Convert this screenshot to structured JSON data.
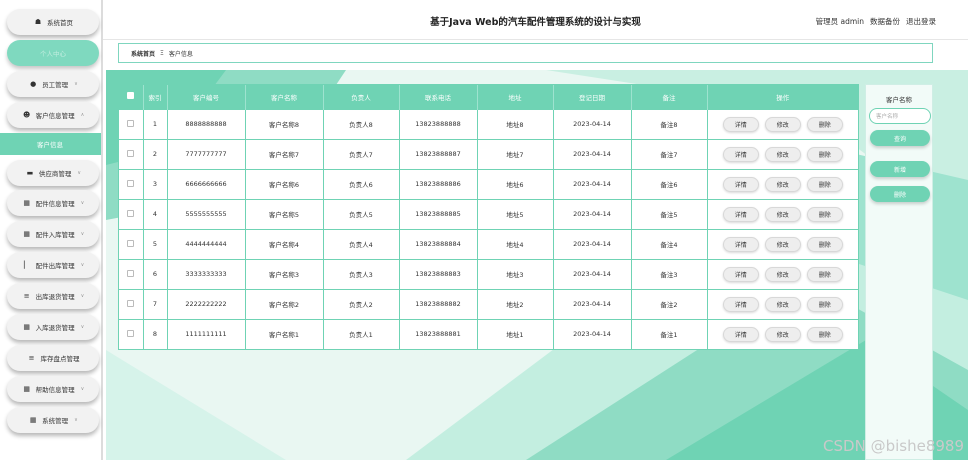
{
  "header": {
    "title": "基于Java Web的汽车配件管理系统的设计与实现",
    "user": "管理员 admin",
    "backup": "数据备份",
    "logout": "退出登录"
  },
  "sidebar": {
    "items": [
      {
        "icon": "home-icon",
        "label": "系统首页"
      },
      {
        "icon": "",
        "label": "个人中心"
      },
      {
        "icon": "pin-icon",
        "label": "员工管理"
      },
      {
        "icon": "person-icon",
        "label": "客户信息管理"
      },
      {
        "sub": "客户信息"
      },
      {
        "icon": "list-icon",
        "label": "供应商管理"
      },
      {
        "icon": "grid-icon",
        "label": "配件信息管理"
      },
      {
        "icon": "grid-icon",
        "label": "配件入库管理"
      },
      {
        "icon": "bar-chart-icon",
        "label": "配件出库管理"
      },
      {
        "icon": "sliders-icon",
        "label": "出库退货管理"
      },
      {
        "icon": "grid-icon",
        "label": "入库退货管理"
      },
      {
        "icon": "menu-icon",
        "label": "库存盘点管理"
      },
      {
        "icon": "grid-icon",
        "label": "帮助信息管理"
      },
      {
        "icon": "table-icon",
        "label": "系统管理"
      }
    ]
  },
  "breadcrumb": {
    "home": "系统首页",
    "separator": "Ξ",
    "current": "客户信息"
  },
  "table": {
    "headers": [
      "索引",
      "客户编号",
      "客户名称",
      "负责人",
      "联系电话",
      "地址",
      "登记日期",
      "备注",
      "操作"
    ],
    "rows": [
      {
        "idx": "1",
        "code": "8888888888",
        "name": "客户名称8",
        "owner": "负责人8",
        "phone": "13823888888",
        "addr": "地址8",
        "date": "2023-04-14",
        "note": "备注8"
      },
      {
        "idx": "2",
        "code": "7777777777",
        "name": "客户名称7",
        "owner": "负责人7",
        "phone": "13823888887",
        "addr": "地址7",
        "date": "2023-04-14",
        "note": "备注7"
      },
      {
        "idx": "3",
        "code": "6666666666",
        "name": "客户名称6",
        "owner": "负责人6",
        "phone": "13823888886",
        "addr": "地址6",
        "date": "2023-04-14",
        "note": "备注6"
      },
      {
        "idx": "4",
        "code": "5555555555",
        "name": "客户名称5",
        "owner": "负责人5",
        "phone": "13823888885",
        "addr": "地址5",
        "date": "2023-04-14",
        "note": "备注5"
      },
      {
        "idx": "5",
        "code": "4444444444",
        "name": "客户名称4",
        "owner": "负责人4",
        "phone": "13823888884",
        "addr": "地址4",
        "date": "2023-04-14",
        "note": "备注4"
      },
      {
        "idx": "6",
        "code": "3333333333",
        "name": "客户名称3",
        "owner": "负责人3",
        "phone": "13823888883",
        "addr": "地址3",
        "date": "2023-04-14",
        "note": "备注3"
      },
      {
        "idx": "7",
        "code": "2222222222",
        "name": "客户名称2",
        "owner": "负责人2",
        "phone": "13823888882",
        "addr": "地址2",
        "date": "2023-04-14",
        "note": "备注2"
      },
      {
        "idx": "8",
        "code": "1111111111",
        "name": "客户名称1",
        "owner": "负责人1",
        "phone": "13823888881",
        "addr": "地址1",
        "date": "2023-04-14",
        "note": "备注1"
      }
    ],
    "actions": {
      "detail": "详情",
      "edit": "修改",
      "delete": "删除"
    }
  },
  "panel": {
    "label": "客户名称",
    "placeholder": "客户名称",
    "search": "查询",
    "add": "新增",
    "delete": "删除"
  },
  "watermark": "CSDN @bishe8989",
  "colors": {
    "accent": "#6fd3b4",
    "accent_light": "#c3eee0"
  }
}
